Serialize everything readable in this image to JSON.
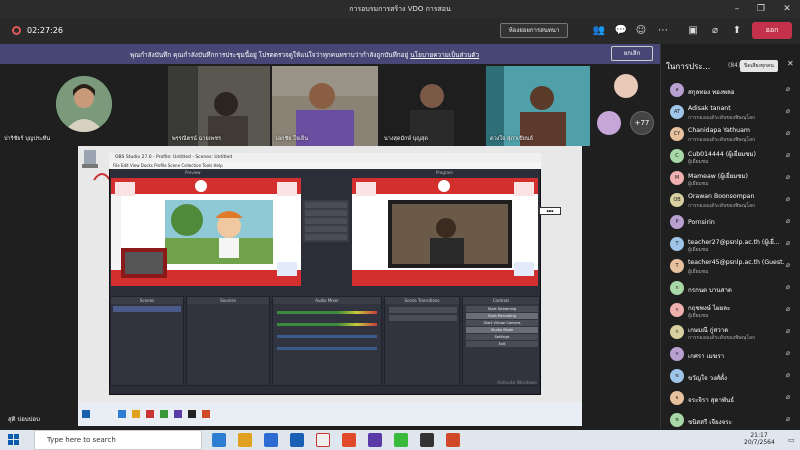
{
  "window": {
    "title": "การอบรมการสร้าง VDO การสอน"
  },
  "toolbar": {
    "timer": "02:27:26",
    "breakout_label": "ห้องย่อยการสนทนา",
    "leave_label": "ออก",
    "icons": [
      "people-icon",
      "chat-icon",
      "reactions-icon",
      "more-icon",
      "camera-icon",
      "mic-off-icon",
      "share-icon"
    ]
  },
  "banner": {
    "text": "พุณกำลังบันทึก  คุณกำลังบันทึกการประชุมนี้อยู่ โปรดตรวจดูให้แน่ใจว่าทุกคนทราบว่ากำลังถูกบันทึกอยู่",
    "link": "นโยบายความเป็นส่วนตัว",
    "dismiss_label": "ยกเลิก"
  },
  "video": {
    "tiles": [
      {
        "name": "ปาริชัยร์ บุญประทีน"
      },
      {
        "name": "พรรณีตรน์ ฉายเพชร"
      },
      {
        "name": "เอกชัย ใจเย็น"
      },
      {
        "name": "นางสุดมักษ์ บุญสุด"
      },
      {
        "name": "ดวงใจ สุภาเขียนย์"
      }
    ],
    "more_count": "+77"
  },
  "obs": {
    "title": "OBS Studio 27.0 - Profile: Untitled - Scenes: Untitled",
    "menu": "File  Edit  View  Docks  Profile  Scene Collection  Tools  Help",
    "preview_label": "Preview",
    "program_label": "Program",
    "docks": [
      "Scenes",
      "Sources",
      "Audio Mixer",
      "Scene Transitions",
      "Controls"
    ],
    "controls": [
      "Start Streaming",
      "Start Recording",
      "Start Virtual Camera",
      "Studio Mode",
      "Settings",
      "Exit"
    ],
    "watermark": "Activate Windows"
  },
  "participants": {
    "header": "ในการประ...",
    "count": "(84)",
    "mute_all": "ปิดเสียงทุกคน",
    "list": [
      {
        "name": "สกุลทอง ทองพลอ",
        "sub": "",
        "initials": "ส"
      },
      {
        "name": "Adisak tanant",
        "sub": "การกองอแด้ระดับของพิษณุโลก",
        "initials": "AT"
      },
      {
        "name": "Chanidapa Yathuam",
        "sub": "การกองอแด้ระดับของพิษณุโลก",
        "initials": "CY"
      },
      {
        "name": "Cub014444 (ผู้เยี่ยมชม)",
        "sub": "ผู้เยี่ยมชม",
        "initials": "C"
      },
      {
        "name": "Mameaw (ผู้เยี่ยมชม)",
        "sub": "ผู้เยี่ยมชม",
        "initials": "M"
      },
      {
        "name": "Orawan Boonsompan",
        "sub": "การกองอแด้ระดับของพิษณุโลก",
        "initials": "OB"
      },
      {
        "name": "Pornsirin",
        "sub": "",
        "initials": "P"
      },
      {
        "name": "teacher27@psnlp.ac.th (ผู้เยี่...",
        "sub": "ผู้เยี่ยมชม",
        "initials": "T"
      },
      {
        "name": "teacher45@psnlp.ac.th (Guest...",
        "sub": "ผู้เยี่ยมชม",
        "initials": "T"
      },
      {
        "name": "กรกนต บานสาด",
        "sub": "",
        "initials": "ก"
      },
      {
        "name": "กฤชพงษ์ ไผยละ",
        "sub": "ผู้เยี่ยมชม",
        "initials": "ก"
      },
      {
        "name": "เกษมณี กู่สวาด",
        "sub": "การกองอแด้ระดับของพิษณุโลก",
        "initials": "ก"
      },
      {
        "name": "เกศรา เมฆรา",
        "sub": "",
        "initials": "ก"
      },
      {
        "name": "ขวัญใจ วงศ์ตั้ง",
        "sub": "",
        "initials": "ข"
      },
      {
        "name": "จระจิรา สุดาพันธ์",
        "sub": "",
        "initials": "จ"
      },
      {
        "name": "ชนิสสรี เจียงจระ",
        "sub": "",
        "initials": "ช"
      }
    ]
  },
  "presenter_name": "สุติ ปอบปอบ",
  "taskbar": {
    "search_placeholder": "Type here to search",
    "time": "21:17",
    "date": "20/7/2564"
  },
  "colors": {
    "accent": "#464775",
    "leave": "#c4314b",
    "background": "#1f1f1f"
  }
}
